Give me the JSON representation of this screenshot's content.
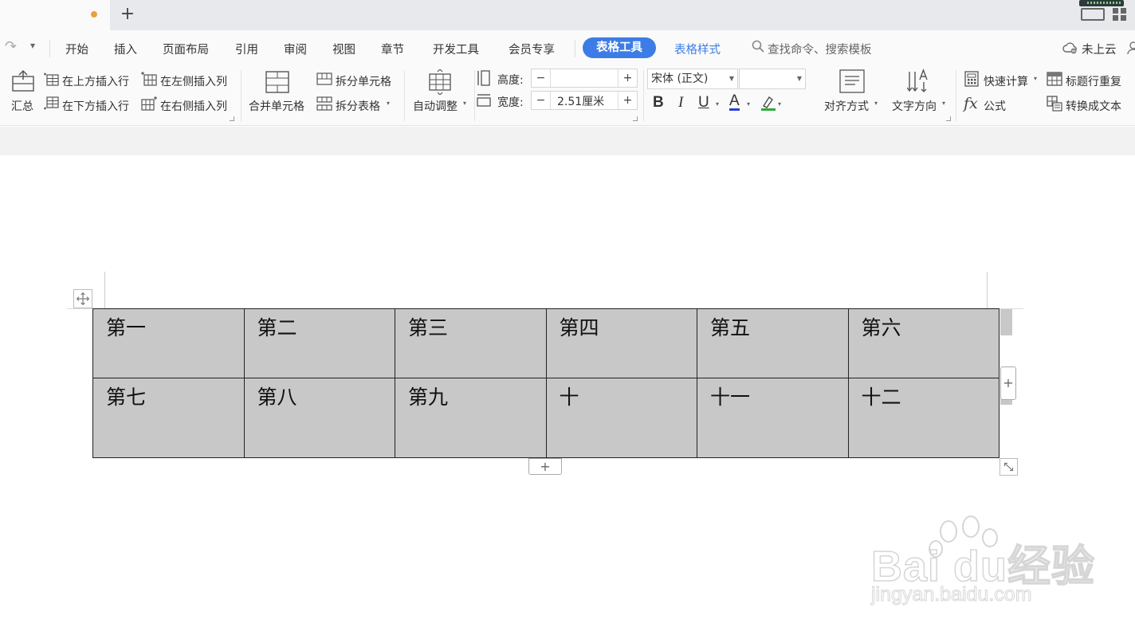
{
  "tabbar": {
    "new_tab": "+"
  },
  "menu": {
    "items": [
      "开始",
      "插入",
      "页面布局",
      "引用",
      "审阅",
      "视图",
      "章节",
      "开发工具",
      "会员专享"
    ],
    "active_tab": "表格工具",
    "style_tab": "表格样式",
    "search_text": "查找命令、搜索模板",
    "cloud_text": "未上云",
    "accent": "#3c7ce6"
  },
  "ribbon": {
    "summary": "汇总",
    "insert_above": "在上方插入行",
    "insert_below": "在下方插入行",
    "insert_left": "在左侧插入列",
    "insert_right": "在右侧插入列",
    "merge_cells": "合并单元格",
    "split_cells": "拆分单元格",
    "split_table": "拆分表格",
    "auto_fit": "自动调整",
    "height_label": "高度:",
    "height_value": "",
    "width_label": "宽度:",
    "width_value": "2.51厘米",
    "font_name": "宋体 (正文)",
    "font_size": "",
    "align": "对齐方式",
    "text_direction": "文字方向",
    "quick_calc": "快速计算",
    "formula": "公式",
    "header_repeat": "标题行重复",
    "convert_text": "转换成文本",
    "bold": "B",
    "italic": "I",
    "underline": "U",
    "font_color": "A",
    "fx": "fx"
  },
  "table": {
    "rows": [
      [
        "第一",
        "第二",
        "第三",
        "第四",
        "第五",
        "第六"
      ],
      [
        "第七",
        "第八",
        "第九",
        "十",
        "十一",
        "十二"
      ]
    ],
    "cell_bg": "#c8c8c8"
  },
  "watermark": {
    "brand": "Bai du经验",
    "url": "jingyan.baidu.com"
  }
}
